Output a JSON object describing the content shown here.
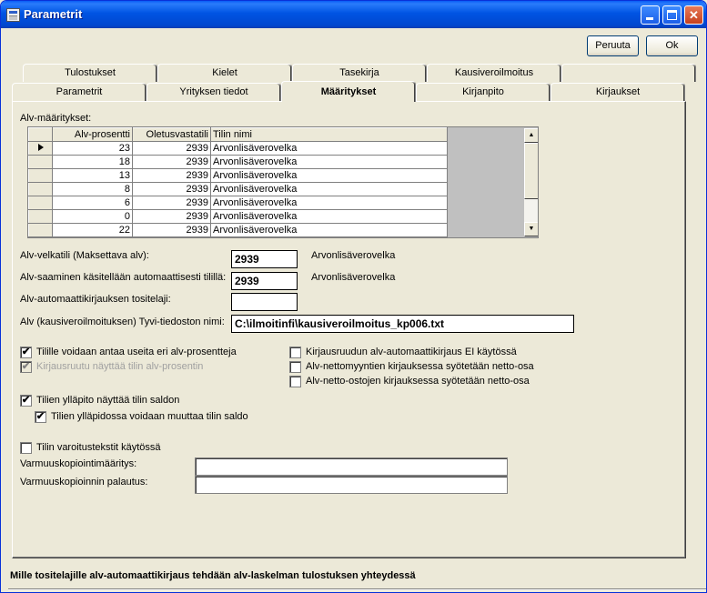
{
  "window": {
    "title": "Parametrit"
  },
  "buttons": {
    "cancel": "Peruuta",
    "ok": "Ok"
  },
  "tabs_row_back": [
    "Tulostukset",
    "Kielet",
    "Tasekirja",
    "Kausiveroilmoitus",
    ""
  ],
  "tabs_row_front": [
    "Parametrit",
    "Yrityksen tiedot",
    "Määritykset",
    "Kirjanpito",
    "Kirjaukset"
  ],
  "grid": {
    "caption": "Alv-määritykset:",
    "columns": [
      "Alv-prosentti",
      "Oletusvastatili",
      "Tilin nimi"
    ],
    "rows": [
      [
        "23",
        "2939",
        "Arvonlisäverovelka"
      ],
      [
        "18",
        "2939",
        "Arvonlisäverovelka"
      ],
      [
        "13",
        "2939",
        "Arvonlisäverovelka"
      ],
      [
        "8",
        "2939",
        "Arvonlisäverovelka"
      ],
      [
        "6",
        "2939",
        "Arvonlisäverovelka"
      ],
      [
        "0",
        "2939",
        "Arvonlisäverovelka"
      ],
      [
        "22",
        "2939",
        "Arvonlisäverovelka"
      ]
    ]
  },
  "fields": {
    "alv_velkatili_label": "Alv-velkatili (Maksettava alv):",
    "alv_velkatili_value": "2939",
    "alv_velkatili_name": "Arvonlisäverovelka",
    "alv_saaminen_label": "Alv-saaminen käsitellään automaattisesti tilillä:",
    "alv_saaminen_value": "2939",
    "alv_saaminen_name": "Arvonlisäverovelka",
    "tositelaji_label": "Alv-automaattikirjauksen tositelaji:",
    "tositelaji_value": "",
    "tyvi_label": "Alv (kausiveroilmoituksen) Tyvi-tiedoston nimi:",
    "tyvi_value": "C:\\ilmoitinfi\\kausiveroilmoitus_kp006.txt"
  },
  "checkboxes": {
    "useita_alv": "Tilille voidaan antaa useita eri alv-prosentteja",
    "kirjausruutu_alv": "Kirjausruutu näyttää tilin alv-prosentin",
    "ei_automaatti": "Kirjausruudun alv-automaattikirjaus EI käytössä",
    "netto_myynti": "Alv-nettomyyntien kirjauksessa syötetään netto-osa",
    "netto_osto": "Alv-netto-ostojen kirjauksessa syötetään netto-osa",
    "yllapito_saldo": "Tilien ylläpito näyttää tilin saldon",
    "yllapito_muuttaa": "Tilien ylläpidossa voidaan muuttaa tilin saldo",
    "varoitus": "Tilin varoitustekstit käytössä"
  },
  "checkmark": "✔",
  "backup": {
    "maaritys_label": "Varmuuskopiointimääritys:",
    "maaritys_value": "",
    "palautus_label": "Varmuuskopioinnin palautus:",
    "palautus_value": ""
  },
  "status_text": "Mille tositelajille alv-automaattikirjaus tehdään alv-laskelman tulostuksen yhteydessä"
}
